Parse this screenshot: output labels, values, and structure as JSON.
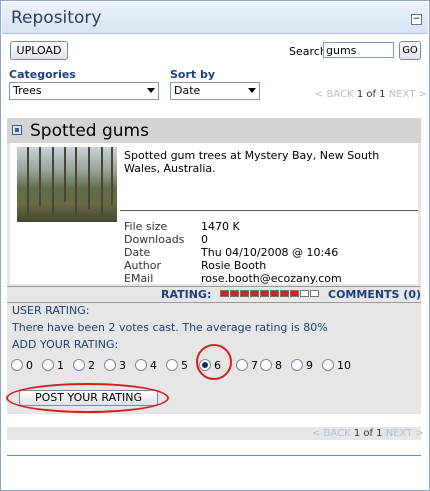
{
  "window": {
    "title": "Repository",
    "collapse_glyph": "−"
  },
  "toolbar": {
    "upload_label": "UPLOAD",
    "search_label": "Search",
    "search_value": "gums",
    "go_label": "GO"
  },
  "filters": {
    "categories_label": "Categories",
    "categories_value": "Trees",
    "sortby_label": "Sort by",
    "sortby_value": "Date"
  },
  "pager_top": {
    "back": "< BACK",
    "current": "1 of 1",
    "next": "NEXT >"
  },
  "item": {
    "title": "Spotted gums",
    "description": "Spotted gum trees at Mystery Bay, New South Wales, Australia.",
    "meta": [
      {
        "label": "File size",
        "value": "1470 K"
      },
      {
        "label": "Downloads",
        "value": "0"
      },
      {
        "label": "Date",
        "value": "Thu 04/10/2008 @ 10:46"
      },
      {
        "label": "Author",
        "value": "Rosie Booth"
      },
      {
        "label": "EMail",
        "value": "rose.booth@ecozany.com"
      }
    ],
    "rating_label": "RATING:",
    "rating_fraction": 0.8,
    "comments_label": "COMMENTS (0)"
  },
  "user_rating": {
    "heading": "USER RATING:",
    "summary": "There have been 2 votes cast. The average rating is 80%",
    "add_label": "ADD YOUR RATING:",
    "options": [
      "0",
      "1",
      "2",
      "3",
      "4",
      "5",
      "6",
      "7",
      "8",
      "9",
      "10"
    ],
    "selected": "6",
    "post_label": "POST YOUR RATING"
  },
  "pager_bottom": {
    "back": "< BACK",
    "current": "1 of 1",
    "next": "NEXT >"
  },
  "colors": {
    "accent": "#1f3f78",
    "rating_fill": "#d92020",
    "highlight": "#d81e1e"
  }
}
